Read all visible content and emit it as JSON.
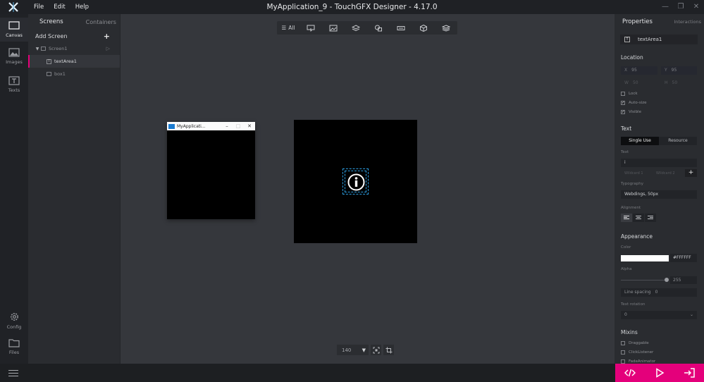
{
  "window": {
    "title": "MyApplication_9 - TouchGFX Designer - 4.17.0",
    "menu": [
      "File",
      "Edit",
      "Help"
    ]
  },
  "rail": {
    "top": [
      {
        "label": "Canvas",
        "icon": "canvas-icon",
        "active": true
      },
      {
        "label": "Images",
        "icon": "images-icon"
      },
      {
        "label": "Texts",
        "icon": "texts-icon"
      }
    ],
    "bottom": [
      {
        "label": "Config",
        "icon": "gear-icon"
      },
      {
        "label": "Files",
        "icon": "folder-icon"
      }
    ]
  },
  "screens_panel": {
    "tabs": [
      "Screens",
      "Containers"
    ],
    "add_screen_label": "Add Screen",
    "tree": {
      "screen": "Screen1",
      "children": [
        "textArea1",
        "box1"
      ]
    }
  },
  "toolbar": {
    "all_label": "All"
  },
  "simulator": {
    "title": "MyApplicati..."
  },
  "canvas": {
    "zoom": "140"
  },
  "properties": {
    "tabs": [
      "Properties",
      "Interactions"
    ],
    "widget_name": "textArea1",
    "location": {
      "heading": "Location",
      "x_label": "X",
      "x": "95",
      "y_label": "Y",
      "y": "95",
      "w_label": "W",
      "w": "50",
      "h_label": "H",
      "h": "50",
      "lock": "Lock",
      "auto_size": "Auto-size",
      "visible": "Visible"
    },
    "text": {
      "heading": "Text",
      "modes": [
        "Single Use",
        "Resource"
      ],
      "text_label": "Text",
      "text_value": "i",
      "wildcard1": "Wildcard 1",
      "wildcard2": "Wildcard 2",
      "typography_label": "Typography",
      "typography": "Webdings, 50px",
      "alignment_label": "Alignment"
    },
    "appearance": {
      "heading": "Appearance",
      "color_label": "Color",
      "color_hex": "#FFFFFF",
      "alpha_label": "Alpha",
      "alpha": "255",
      "line_spacing_label": "Line spacing",
      "line_spacing": "0",
      "rotation_label": "Text rotation",
      "rotation": "0"
    },
    "mixins": {
      "heading": "Mixins",
      "items": [
        "Draggable",
        "ClickListener",
        "FadeAnimator"
      ]
    }
  },
  "colors": {
    "accent": "#e4007b",
    "selection": "#2b9cdf",
    "logo": "#5ab4e6"
  }
}
